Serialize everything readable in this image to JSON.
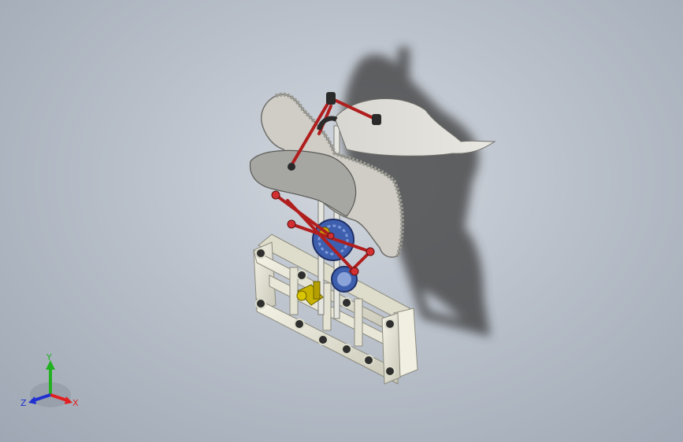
{
  "viewport": {
    "background_top": "#d2d7de",
    "background_bottom": "#9ea7b3"
  },
  "model": {
    "shadow_color": "#3a3a3a",
    "body_color": "#c9c9c4",
    "frame_color": "#ecebdc",
    "link_color": "#b01e1e",
    "gear_color": "#3e5fae",
    "knob_color": "#c8b400"
  },
  "triad": {
    "x_label": "X",
    "y_label": "Y",
    "z_label": "Z",
    "x_color": "#e02020",
    "y_color": "#20b020",
    "z_color": "#2030d0"
  }
}
